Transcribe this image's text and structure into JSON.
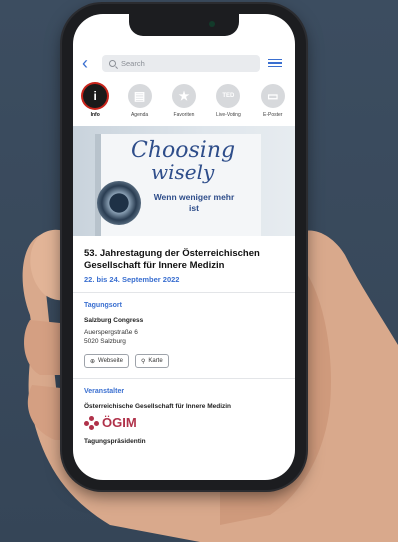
{
  "nav": {
    "search_placeholder": "Search"
  },
  "tabs": [
    {
      "label": "Info",
      "icon": "info-icon",
      "glyph": "i"
    },
    {
      "label": "Agenda",
      "icon": "agenda-icon",
      "glyph": "▤"
    },
    {
      "label": "Favoriten",
      "icon": "star-icon",
      "glyph": "★"
    },
    {
      "label": "Live-Voting",
      "icon": "ted-icon",
      "glyph": "TED"
    },
    {
      "label": "E-Poster",
      "icon": "monitor-icon",
      "glyph": "▭"
    }
  ],
  "banner": {
    "line1": "Choosing",
    "line2": "wisely",
    "tagline": "Wenn weniger mehr ist"
  },
  "event": {
    "title": "53. Jahrestagung der Österreichischen Gesellschaft für Innere Medizin",
    "date": "22. bis 24. September 2022"
  },
  "venue": {
    "section": "Tagungsort",
    "name": "Salzburg Congress",
    "street": "Auerspergstraße 6",
    "city": "5020 Salzburg",
    "website_btn": "Webseite",
    "map_btn": "Karte"
  },
  "organizer": {
    "section": "Veranstalter",
    "name": "Österreichische Gesellschaft für Innere Medizin",
    "logo_text": "ÖGIM",
    "president_label": "Tagungspräsidentin"
  },
  "colors": {
    "accent": "#3a6fd0",
    "logo": "#b0324a",
    "active_ring": "#c8241b"
  }
}
